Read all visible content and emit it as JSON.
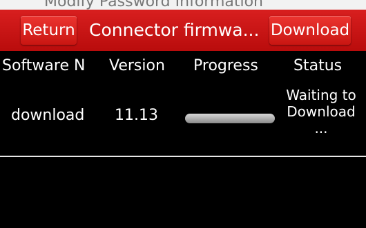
{
  "background_strip": {
    "text": "Modify Password Information"
  },
  "header": {
    "return_label": "Return",
    "title": "Connector firmwa...",
    "download_label": "Download"
  },
  "table": {
    "columns": [
      "Software N",
      "Version",
      "Progress",
      "Status"
    ],
    "rows": [
      {
        "name": "download",
        "version": "11.13",
        "progress": 0,
        "status_line1": "Waiting to",
        "status_line2": "Download",
        "status_line3": "..."
      }
    ]
  },
  "colors": {
    "header_red": "#c8161a",
    "background": "#000000",
    "text": "#ffffff"
  }
}
